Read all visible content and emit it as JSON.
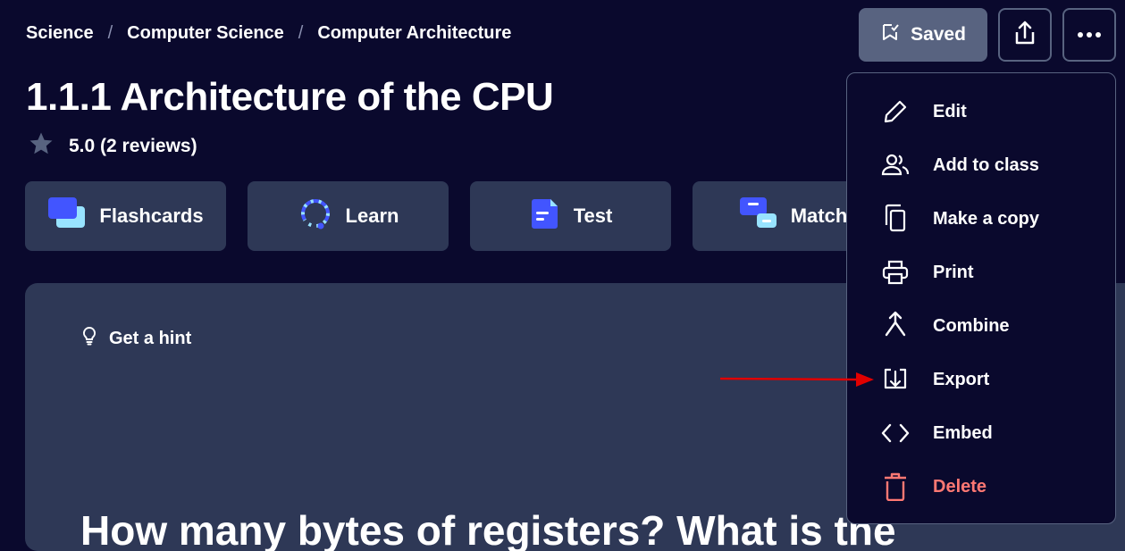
{
  "breadcrumb": [
    "Science",
    "Computer Science",
    "Computer Architecture"
  ],
  "title": "1.1.1 Architecture of the CPU",
  "rating": {
    "text": "5.0 (2 reviews)"
  },
  "modes": [
    {
      "label": "Flashcards",
      "icon": "flashcards-icon"
    },
    {
      "label": "Learn",
      "icon": "learn-icon"
    },
    {
      "label": "Test",
      "icon": "test-icon"
    },
    {
      "label": "Match",
      "icon": "match-icon"
    }
  ],
  "card": {
    "hint": "Get a hint",
    "question_partial": "How many bytes of registers? What is the"
  },
  "header": {
    "saved_label": "Saved"
  },
  "menu": {
    "items": [
      {
        "label": "Edit",
        "icon": "pencil-icon"
      },
      {
        "label": "Add to class",
        "icon": "people-icon"
      },
      {
        "label": "Make a copy",
        "icon": "copy-icon"
      },
      {
        "label": "Print",
        "icon": "printer-icon"
      },
      {
        "label": "Combine",
        "icon": "merge-icon"
      },
      {
        "label": "Export",
        "icon": "export-icon"
      },
      {
        "label": "Embed",
        "icon": "code-icon"
      },
      {
        "label": "Delete",
        "icon": "trash-icon",
        "danger": true
      }
    ]
  },
  "colors": {
    "background": "#0a092d",
    "surface": "#2e3856",
    "muted": "#586380",
    "danger": "#ff7873",
    "accent": "#4255ff",
    "annotation_arrow": "#e00000"
  }
}
